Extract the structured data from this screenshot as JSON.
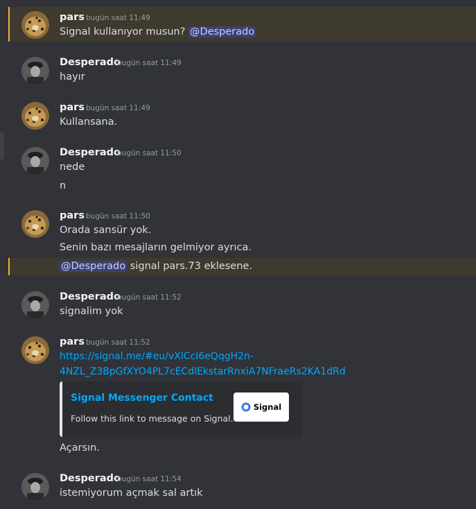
{
  "theme": {
    "background": "#313338",
    "highlight": "#3f3a2e",
    "highlight_bar": "#f0b232",
    "link": "#00a8fc",
    "mention_bg": "#3c4270"
  },
  "icons": {
    "pars_avatar": "leopard-avatar-icon",
    "desperado_avatar": "soldier-avatar-icon",
    "signal_logo": "signal-logo-icon"
  },
  "messages": {
    "m1": {
      "author": "pars",
      "time": "bugün saat 11:49",
      "text": "Signal kullanıyor musun? ",
      "mention": "@Desperado"
    },
    "m2": {
      "author": "Desperado",
      "time": "bugün saat 11:49",
      "text": "hayır"
    },
    "m3": {
      "author": "pars",
      "time": "bugün saat 11:49",
      "text": "Kullansana."
    },
    "m4": {
      "author": "Desperado",
      "time": "bugün saat 11:50",
      "lines": [
        "nede",
        "n"
      ]
    },
    "m5": {
      "author": "pars",
      "time": "bugün saat 11:50",
      "lines": [
        "Orada sansür yok.",
        "Senin bazı mesajların gelmiyor ayrıca."
      ],
      "mention": "@Desperado",
      "mention_text": " signal pars.73 eklesene."
    },
    "m6": {
      "author": "Desperado",
      "time": "bugün saat 11:52",
      "text": "signalim yok"
    },
    "m7": {
      "author": "pars",
      "time": "bugün saat 11:52",
      "link_line1": "https://signal.me/#eu/vXlCcI6eQqgH2n-",
      "link_line2": "4NZL_Z3BpGfXYO4PL7cECdlEkstarRnxiA7NFraeRs2KA1dRd",
      "embed": {
        "title": "Signal Messenger Contact",
        "description": "Follow this link to message on Signal.",
        "thumb_label": "Signal"
      },
      "after": "Açarsın."
    },
    "m8": {
      "author": "Desperado",
      "time": "bugün saat 11:54",
      "text": "istemiyorum açmak sal artık"
    }
  }
}
